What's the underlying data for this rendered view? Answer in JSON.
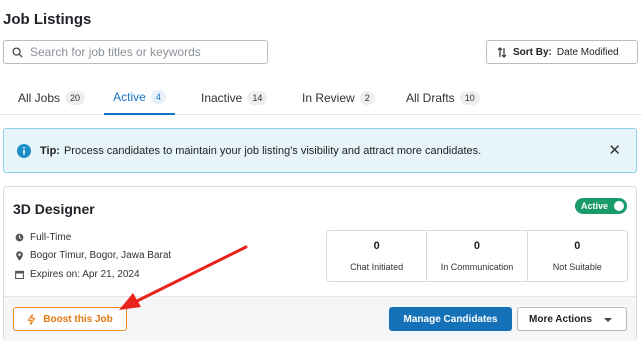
{
  "page": {
    "title": "Job Listings"
  },
  "search": {
    "placeholder": "Search for job titles or keywords",
    "icon": "search-icon"
  },
  "sort": {
    "label": "Sort By:",
    "value": "Date Modified",
    "icon": "sort-arrows-icon"
  },
  "tabs": [
    {
      "label": "All Jobs",
      "count": "20",
      "active": false
    },
    {
      "label": "Active",
      "count": "4",
      "active": true
    },
    {
      "label": "Inactive",
      "count": "14",
      "active": false
    },
    {
      "label": "In Review",
      "count": "2",
      "active": false
    },
    {
      "label": "All Drafts",
      "count": "10",
      "active": false
    }
  ],
  "tip": {
    "bold": "Tip:",
    "text": "Process candidates to maintain your job listing's visibility and attract more candidates.",
    "close": "✕"
  },
  "job": {
    "title": "3D Designer",
    "status": "Active",
    "employment_type": "Full-Time",
    "location": "Bogor Timur, Bogor, Jawa Barat",
    "expires": "Expires on: Apr 21, 2024",
    "stats": [
      {
        "value": "0",
        "label": "Chat Initiated"
      },
      {
        "value": "0",
        "label": "In Communication"
      },
      {
        "value": "0",
        "label": "Not Suitable"
      }
    ],
    "actions": {
      "boost": "Boost this Job",
      "manage": "Manage Candidates",
      "more": "More Actions"
    }
  },
  "colors": {
    "primary": "#1572b8",
    "active_tab": "#1675c6",
    "status_active": "#1a9b6c",
    "boost": "#f08a24",
    "annotation_arrow": "#e8231e",
    "tip_background": "#e7f5fb"
  }
}
